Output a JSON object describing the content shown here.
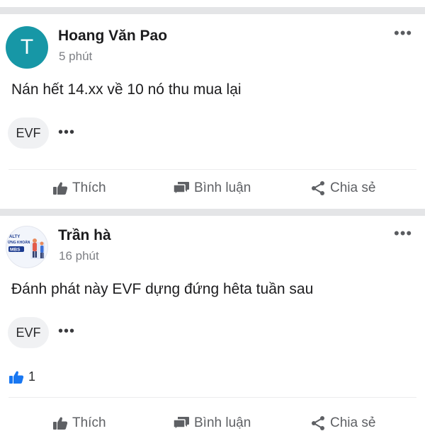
{
  "posts": [
    {
      "author": "Hoang Văn Pao",
      "avatar_letter": "T",
      "time": "5 phút",
      "content": "Nán hết 14.xx về 10 nó thu mua lại",
      "tag": "EVF",
      "more": "•••"
    },
    {
      "author": "Trần hà",
      "avatar_texts": [
        "ALTY",
        "ỨNG KHOẢN",
        "MBS"
      ],
      "time": "16 phút",
      "content": "Đánh phát này EVF dựng đứng hêta tuần sau",
      "tag": "EVF",
      "more": "•••",
      "like_count": "1"
    }
  ],
  "actions": {
    "like": "Thích",
    "comment": "Bình luận",
    "share": "Chia sẻ"
  },
  "colors": {
    "avatar_bg": "#1797a6",
    "like_blue": "#1877f2",
    "icon_gray": "#5e6064",
    "divider": "#e4e5e7"
  },
  "icons": [
    "thumbs-up-icon",
    "comment-icon",
    "share-icon",
    "more-icon"
  ]
}
